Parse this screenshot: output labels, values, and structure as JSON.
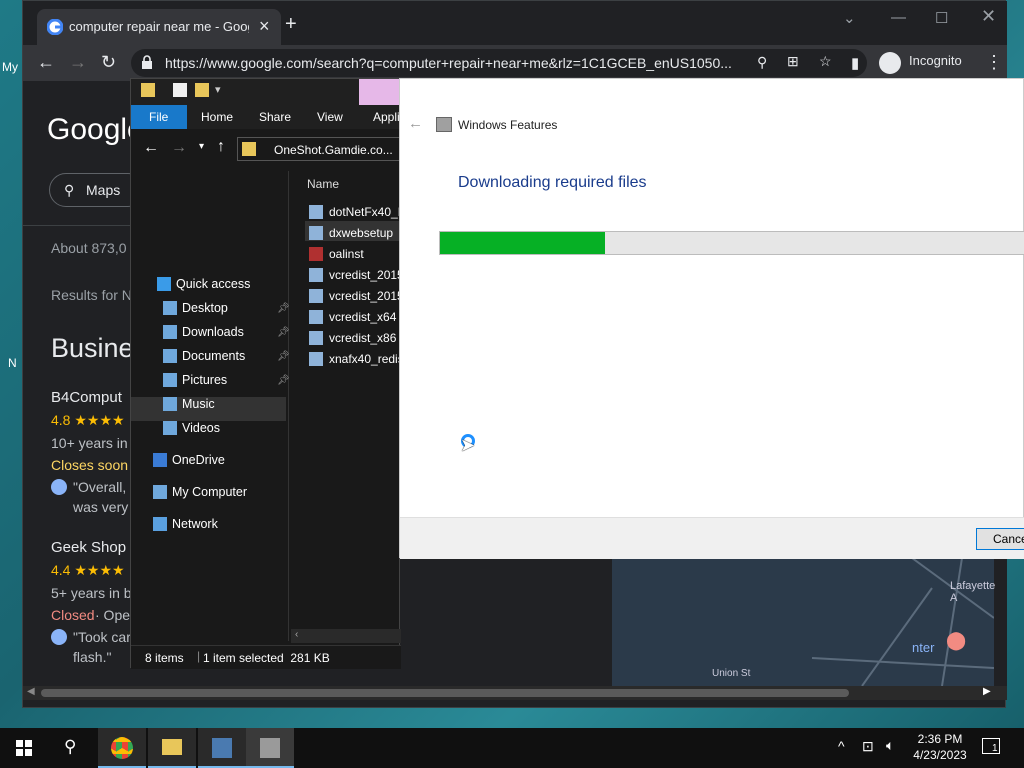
{
  "desktop": {
    "left_fragments": [
      "My",
      "N"
    ]
  },
  "browser": {
    "tab_title": "computer repair near me - Google",
    "url": "https://www.google.com/search?q=computer+repair+near+me&rlz=1C1GCEB_enUS1050...",
    "incognito_label": "Incognito",
    "page": {
      "logo": "Google",
      "maps_chip": "Maps",
      "about": "About 873,0",
      "results_for": "Results for N",
      "section_heading": "Busine",
      "results": [
        {
          "name": "B4Comput",
          "rating": "4.8 ★★★★",
          "years": "10+ years in",
          "status": "Closes soon",
          "review_line1": "\"Overall, I",
          "review_line2": "was very"
        },
        {
          "name": "Geek Shop",
          "rating": "4.4 ★★★★",
          "years": "5+ years in b",
          "status": "Closed",
          "status_extra": " · Ope",
          "review_line1": "\"Took car",
          "review_line2": "flash.\""
        }
      ],
      "map_labels": [
        "Lafayette A",
        "nter",
        "Union St"
      ]
    }
  },
  "explorer": {
    "ribbon_tabs": [
      "File",
      "Home",
      "Share",
      "View",
      "Appli"
    ],
    "address": "OneShot.Gamdie.co...",
    "nav_items": [
      {
        "label": "Quick access",
        "icon": "star-icon",
        "pinned": false
      },
      {
        "label": "Desktop",
        "icon": "desktop-icon",
        "pinned": true
      },
      {
        "label": "Downloads",
        "icon": "download-icon",
        "pinned": true
      },
      {
        "label": "Documents",
        "icon": "document-icon",
        "pinned": true
      },
      {
        "label": "Pictures",
        "icon": "picture-icon",
        "pinned": true
      },
      {
        "label": "Music",
        "icon": "music-icon",
        "pinned": false
      },
      {
        "label": "Videos",
        "icon": "video-icon",
        "pinned": false
      },
      {
        "label": "OneDrive",
        "icon": "cloud-icon",
        "pinned": false
      },
      {
        "label": "My Computer",
        "icon": "computer-icon",
        "pinned": false
      },
      {
        "label": "Network",
        "icon": "network-icon",
        "pinned": false
      }
    ],
    "column_header": "Name",
    "files": [
      "dotNetFx40_F",
      "dxwebsetup",
      "oalinst",
      "vcredist_2015",
      "vcredist_2015",
      "vcredist_x64",
      "vcredist_x86",
      "xnafx40_redis"
    ],
    "selected_file": "dxwebsetup",
    "status_items": "8 items",
    "status_selected": "1 item selected  281 KB"
  },
  "windows_features": {
    "title": "Windows Features",
    "heading": "Downloading required files",
    "progress_fraction": 0.28,
    "cancel_label": "Cance",
    "progress_color": "#06b025"
  },
  "taskbar": {
    "time": "2:36 PM",
    "date": "4/23/2023",
    "notification_count": "1"
  }
}
